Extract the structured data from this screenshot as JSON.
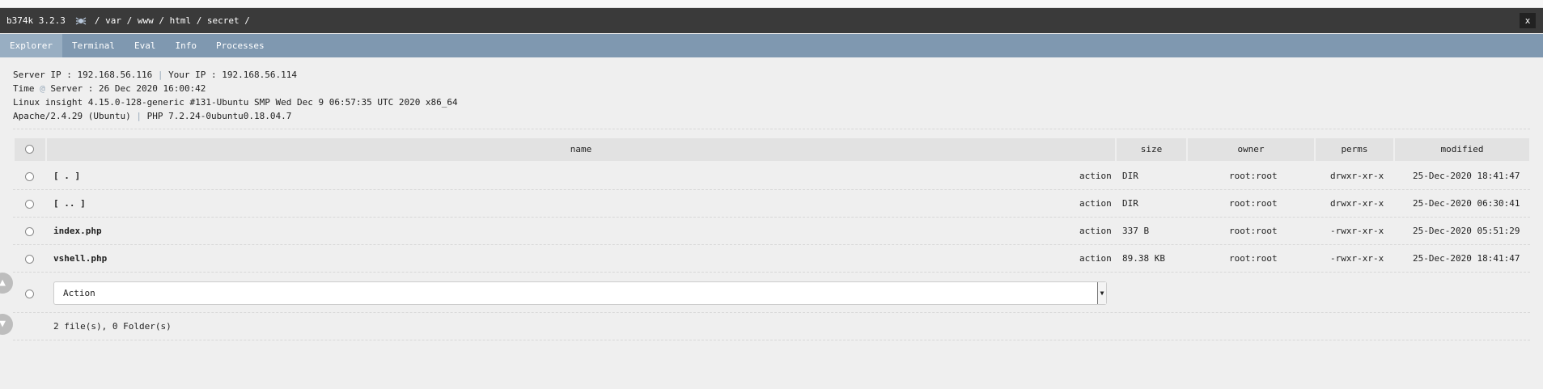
{
  "header": {
    "brand": "b374k 3.2.3",
    "path": "/ var / www / html / secret /",
    "close_label": "x"
  },
  "nav": {
    "tabs": [
      "Explorer",
      "Terminal",
      "Eval",
      "Info",
      "Processes"
    ],
    "active": "Explorer"
  },
  "info": {
    "server_ip_label": "Server IP : 192.168.56.116",
    "your_ip_label": "Your IP : 192.168.56.114",
    "time_label": "Time",
    "server_time": "Server : 26 Dec 2020 16:00:42",
    "uname": "Linux insight 4.15.0-128-generic #131-Ubuntu SMP Wed Dec 9 06:57:35 UTC 2020 x86_64",
    "apache": "Apache/2.4.29 (Ubuntu)",
    "php": "PHP 7.2.24-0ubuntu0.18.04.7"
  },
  "table": {
    "columns": [
      "name",
      "size",
      "owner",
      "perms",
      "modified"
    ],
    "rows": [
      {
        "name": "[ . ]",
        "action": "action",
        "size": "DIR",
        "owner": "root:root",
        "perms": "drwxr-xr-x",
        "modified": "25-Dec-2020 18:41:47"
      },
      {
        "name": "[ .. ]",
        "action": "action",
        "size": "DIR",
        "owner": "root:root",
        "perms": "drwxr-xr-x",
        "modified": "25-Dec-2020 06:30:41"
      },
      {
        "name": "index.php",
        "action": "action",
        "size": "337 B",
        "owner": "root:root",
        "perms": "-rwxr-xr-x",
        "modified": "25-Dec-2020 05:51:29"
      },
      {
        "name": "vshell.php",
        "action": "action",
        "size": "89.38 KB",
        "owner": "root:root",
        "perms": "-rwxr-xr-x",
        "modified": "25-Dec-2020 18:41:47"
      }
    ],
    "action_select": "Action",
    "summary": "2 file(s), 0 Folder(s)"
  },
  "colors": {
    "header_bg": "#3a3a3a",
    "nav_bg": "#7f98b0",
    "nav_active": "#98aec2",
    "page_bg": "#efefef"
  }
}
